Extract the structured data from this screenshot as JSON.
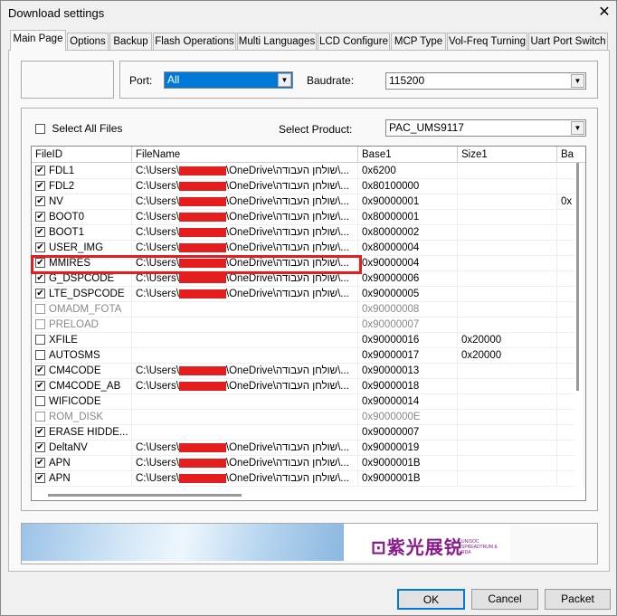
{
  "window": {
    "title": "Download settings"
  },
  "tabs": [
    "Main Page",
    "Options",
    "Backup",
    "Flash Operations",
    "Multi Languages",
    "LCD Configure",
    "MCP Type",
    "Vol-Freq Turning",
    "Uart Port Switch"
  ],
  "port": {
    "label": "Port:",
    "value": "All"
  },
  "baudrate": {
    "label": "Baudrate:",
    "value": "115200"
  },
  "select_all": {
    "label": "Select All Files",
    "checked": false
  },
  "product": {
    "label": "Select Product:",
    "value": "PAC_UMS9117"
  },
  "columns": [
    "FileID",
    "FileName",
    "Base1",
    "Size1",
    "Ba"
  ],
  "path_prefix": "C:\\Users\\",
  "path_suffix": "\\OneDrive\\שולחן העבודה\\...",
  "rows": [
    {
      "id": "FDL1",
      "checked": true,
      "disabled": false,
      "path": true,
      "base1": "0x6200",
      "size1": "",
      "ba": ""
    },
    {
      "id": "FDL2",
      "checked": true,
      "disabled": false,
      "path": true,
      "base1": "0x80100000",
      "size1": "",
      "ba": ""
    },
    {
      "id": "NV",
      "checked": true,
      "disabled": false,
      "path": true,
      "base1": "0x90000001",
      "size1": "",
      "ba": "0x"
    },
    {
      "id": "BOOT0",
      "checked": true,
      "disabled": false,
      "path": true,
      "base1": "0x80000001",
      "size1": "",
      "ba": ""
    },
    {
      "id": "BOOT1",
      "checked": true,
      "disabled": false,
      "path": true,
      "base1": "0x80000002",
      "size1": "",
      "ba": ""
    },
    {
      "id": "USER_IMG",
      "checked": true,
      "disabled": false,
      "path": true,
      "base1": "0x80000004",
      "size1": "",
      "ba": ""
    },
    {
      "id": "MMIRES",
      "checked": true,
      "disabled": false,
      "path": true,
      "base1": "0x90000004",
      "size1": "",
      "ba": "",
      "highlighted": true
    },
    {
      "id": "G_DSPCODE",
      "checked": true,
      "disabled": false,
      "path": true,
      "base1": "0x90000006",
      "size1": "",
      "ba": ""
    },
    {
      "id": "LTE_DSPCODE",
      "checked": true,
      "disabled": false,
      "path": true,
      "base1": "0x90000005",
      "size1": "",
      "ba": ""
    },
    {
      "id": "OMADM_FOTA",
      "checked": false,
      "disabled": true,
      "path": false,
      "base1": "0x90000008",
      "size1": "",
      "ba": ""
    },
    {
      "id": "PRELOAD",
      "checked": false,
      "disabled": true,
      "path": false,
      "base1": "0x90000007",
      "size1": "",
      "ba": ""
    },
    {
      "id": "XFILE",
      "checked": false,
      "disabled": false,
      "path": false,
      "base1": "0x90000016",
      "size1": "0x20000",
      "ba": ""
    },
    {
      "id": "AUTOSMS",
      "checked": false,
      "disabled": false,
      "path": false,
      "base1": "0x90000017",
      "size1": "0x20000",
      "ba": ""
    },
    {
      "id": "CM4CODE",
      "checked": true,
      "disabled": false,
      "path": true,
      "base1": "0x90000013",
      "size1": "",
      "ba": ""
    },
    {
      "id": "CM4CODE_AB",
      "checked": true,
      "disabled": false,
      "path": true,
      "base1": "0x90000018",
      "size1": "",
      "ba": ""
    },
    {
      "id": "WIFICODE",
      "checked": false,
      "disabled": false,
      "path": false,
      "base1": "0x90000014",
      "size1": "",
      "ba": ""
    },
    {
      "id": "ROM_DISK",
      "checked": false,
      "disabled": true,
      "path": false,
      "base1": "0x9000000E",
      "size1": "",
      "ba": ""
    },
    {
      "id": "ERASE HIDDE...",
      "checked": true,
      "disabled": false,
      "path": false,
      "base1": "0x90000007",
      "size1": "",
      "ba": ""
    },
    {
      "id": "DeltaNV",
      "checked": true,
      "disabled": false,
      "path": true,
      "base1": "0x90000019",
      "size1": "",
      "ba": ""
    },
    {
      "id": "APN",
      "checked": true,
      "disabled": false,
      "path": true,
      "base1": "0x9000001B",
      "size1": "",
      "ba": ""
    },
    {
      "id": "APN",
      "checked": true,
      "disabled": false,
      "path": true,
      "base1": "0x9000001B",
      "size1": "",
      "ba": ""
    }
  ],
  "banner": {
    "logo_cn": "紫光展锐",
    "logo_en": "UNISOC SPREADTRUM & RDA",
    "logo_color": "#8b1a8b"
  },
  "highlight_color": "#e41e1e",
  "buttons": {
    "ok": "OK",
    "cancel": "Cancel",
    "packet": "Packet"
  }
}
